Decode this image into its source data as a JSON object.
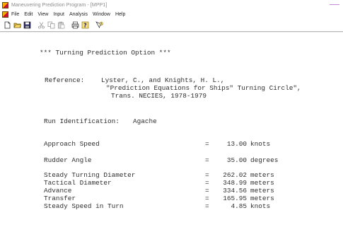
{
  "window": {
    "title": "Maneuvering Prediction Program - [MPP1]"
  },
  "menu": {
    "items": [
      "File",
      "Edit",
      "View",
      "Input",
      "Analysis",
      "Window",
      "Help"
    ]
  },
  "toolbar": {
    "buttons": [
      "new-icon",
      "open-icon",
      "save-icon",
      "cut-icon",
      "copy-icon",
      "paste-icon",
      "print-icon",
      "help-icon",
      "context-help-icon"
    ]
  },
  "document": {
    "heading": "*** Turning Prediction Option ***",
    "reference_label": "Reference:",
    "reference_authors": "Lyster, C., and Knights, H. L.,",
    "reference_title": "\"Prediction Equations for Ships\" Turning Circle\",",
    "reference_source": "Trans. NECIES, 1978-1979",
    "run_id_label": "Run Identification:",
    "run_id_value": "Agache",
    "rows": [
      {
        "label": "Approach Speed",
        "eq": "=",
        "value": "13.00",
        "unit": "knots"
      },
      {
        "label": "Rudder Angle",
        "eq": "=",
        "value": "35.00",
        "unit": "degrees"
      },
      {
        "label": "Steady Turning Diameter",
        "eq": "=",
        "value": "262.02",
        "unit": "meters"
      },
      {
        "label": "Tactical Diameter",
        "eq": "=",
        "value": "348.99",
        "unit": "meters"
      },
      {
        "label": "Advance",
        "eq": "=",
        "value": "334.56",
        "unit": "meters"
      },
      {
        "label": "Transfer",
        "eq": "=",
        "value": "165.95",
        "unit": "meters"
      },
      {
        "label": "Steady Speed in Turn",
        "eq": "=",
        "value": "4.85",
        "unit": "knots"
      }
    ]
  }
}
